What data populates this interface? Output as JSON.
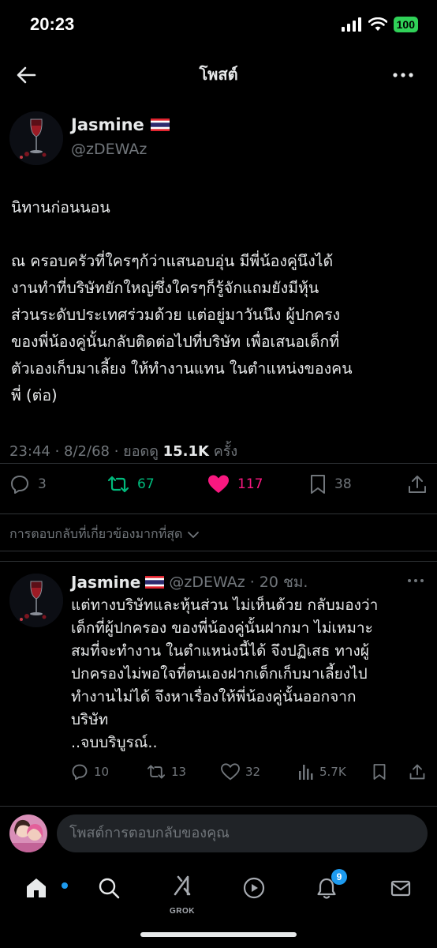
{
  "status_bar": {
    "time": "20:23",
    "battery": "100"
  },
  "header": {
    "title": "โพสต์"
  },
  "post": {
    "display_name": "Jasmine",
    "handle": "@zDEWAz",
    "text_lines": [
      "นิทานก่อนนอน",
      "ณ ครอบครัวที่ใครๆก้ว่าแสนอบอุ่น มีพี่น้องคู่นึงได้",
      "งานทำที่บริษัทยักใหญ่ซึ่งใครๆก็รู้จักแถมยังมีหุ้น",
      "ส่วนระดับประเทศร่วมด้วย แต่อยู่มาวันนึง ผู้ปกครง",
      "ของพี่น้องคู่นั้นกลับติดต่อไปที่บริษัท เพื่อเสนอเด็กที่",
      "ตัวเองเก็บมาเลี้ยง ให้ทำงานแทน ในตำแหน่งของคน",
      "พี่ (ต่อ)"
    ],
    "time": "23:44 · 8/2/68 · ยอดดู",
    "views": "15.1K",
    "views_suffix": "ครั้ง",
    "replies": "3",
    "reposts": "67",
    "likes": "117",
    "bookmarks": "38"
  },
  "relevant_label": "การตอบกลับที่เกี่ยวข้องมากที่สุด",
  "reply": {
    "display_name": "Jasmine",
    "handle_time": "@zDEWAz · 20 ชม.",
    "text_lines": [
      "แต่ทางบริษัทและหุ้นส่วน ไม่เห็นด้วย กลับมองว่า",
      "เด็กที่ผู้ปกครอง ของพี่น้องคู่นั้นฝากมา ไม่เหมาะ",
      "สมที่จะทำงาน ในตำแหน่งนี้ได้ จึงปฏิเสธ ทางผู้",
      "ปกครองไม่พอใจที่ตนเองฝากเด็กเก็บมาเลี้ยงไป",
      "ทำงานไม่ได้ จึงหาเรื่องให้พี่น้องคู่นั้นออกจาก",
      "บริษัท",
      "..จบบริบูรณ์.."
    ],
    "replies": "10",
    "reposts": "13",
    "likes": "32",
    "views": "5.7K"
  },
  "compose": {
    "placeholder": "โพสต์การตอบกลับของคุณ"
  },
  "tabbar": {
    "grok_label": "GROK",
    "notifications_badge": "9"
  },
  "colors": {
    "accent": "#1d9bf0",
    "repost_active": "#00ba7c",
    "like_active": "#f91880",
    "battery": "#30d158"
  }
}
